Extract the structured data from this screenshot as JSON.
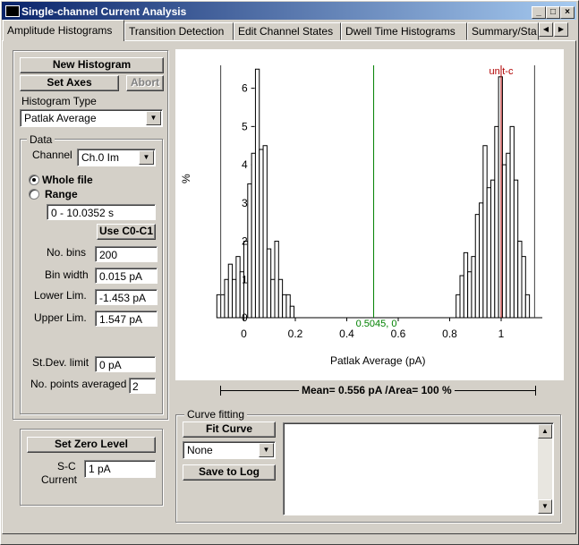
{
  "window": {
    "title": "Single-channel Current Analysis",
    "controls": [
      "_",
      "□",
      "×"
    ]
  },
  "tabs": [
    {
      "label": "Amplitude Histograms",
      "active": true
    },
    {
      "label": "Transition Detection"
    },
    {
      "label": "Edit Channel States"
    },
    {
      "label": "Dwell Time Histograms"
    },
    {
      "label": "Summary/Sta"
    }
  ],
  "tab_scroll": {
    "left": "◀",
    "right": "▶"
  },
  "left_panel": {
    "new_histogram": "New Histogram",
    "set_axes": "Set Axes",
    "abort": "Abort",
    "histogram_type_label": "Histogram Type",
    "histogram_type_value": "Patlak Average",
    "data_group": {
      "title": "Data",
      "channel_label": "Channel",
      "channel_value": "Ch.0 Im",
      "whole_file": "Whole file",
      "range": "Range",
      "range_value": "0 - 10.0352 s",
      "use_c0c1": "Use C0-C1",
      "no_bins_label": "No. bins",
      "no_bins": "200",
      "bin_width_label": "Bin width",
      "bin_width": "0.015 pA",
      "lower_lim_label": "Lower Lim.",
      "lower_lim": "-1.453 pA",
      "upper_lim_label": "Upper Lim.",
      "upper_lim": "1.547 pA",
      "stdev_label": "St.Dev. limit",
      "stdev": "0 pA",
      "npoints_label": "No. points averaged",
      "npoints": "2"
    },
    "set_zero_level": "Set Zero Level",
    "sc_current_label_1": "S-C",
    "sc_current_label_2": "Current",
    "sc_current": "1 pA"
  },
  "chart_data": {
    "type": "bar",
    "xlabel": "Patlak Average (pA)",
    "ylabel": "%",
    "xlim": [
      -0.12,
      1.16
    ],
    "ylim": [
      0,
      6.6
    ],
    "xticks": [
      "0",
      "0.2",
      "0.4",
      "0.6",
      "0.8",
      "1"
    ],
    "yticks": [
      "0",
      "1",
      "2",
      "3",
      "4",
      "5",
      "6"
    ],
    "bin_width": 0.015,
    "bin_starts": [
      -0.105,
      -0.09,
      -0.075,
      -0.06,
      -0.045,
      -0.03,
      -0.015,
      0.0,
      0.015,
      0.03,
      0.045,
      0.06,
      0.075,
      0.09,
      0.105,
      0.12,
      0.135,
      0.15,
      0.165,
      0.18,
      0.195,
      0.81,
      0.825,
      0.84,
      0.855,
      0.87,
      0.885,
      0.9,
      0.915,
      0.93,
      0.945,
      0.96,
      0.975,
      0.99,
      1.005,
      1.02,
      1.035,
      1.05,
      1.065,
      1.08,
      1.095,
      1.11
    ],
    "values": [
      0.6,
      0.6,
      1.0,
      1.4,
      1.0,
      1.6,
      1.2,
      2.0,
      3.5,
      4.3,
      6.5,
      4.4,
      4.5,
      1.8,
      1.0,
      2.0,
      1.0,
      0.6,
      0.6,
      0.3,
      0.0,
      0.0,
      0.6,
      1.1,
      1.7,
      1.2,
      1.6,
      2.7,
      3.0,
      4.5,
      3.4,
      3.6,
      5.0,
      6.3,
      4.0,
      4.3,
      5.0,
      3.6,
      2.0,
      1.6,
      0.6,
      0.0
    ],
    "annotations": [
      {
        "label": "0.5045, 0",
        "x": 0.5045,
        "color": "#008000"
      },
      {
        "label": "unit-c",
        "x": 1.0,
        "color": "#b00000"
      }
    ],
    "cursor_lines_x": [
      -0.09,
      1.13
    ],
    "summary": "Mean= 0.556 pA /Area= 100 %"
  },
  "curve_fitting": {
    "title": "Curve fitting",
    "fit_curve": "Fit Curve",
    "equation": "None",
    "save_to_log": "Save to Log",
    "results_text": ""
  }
}
